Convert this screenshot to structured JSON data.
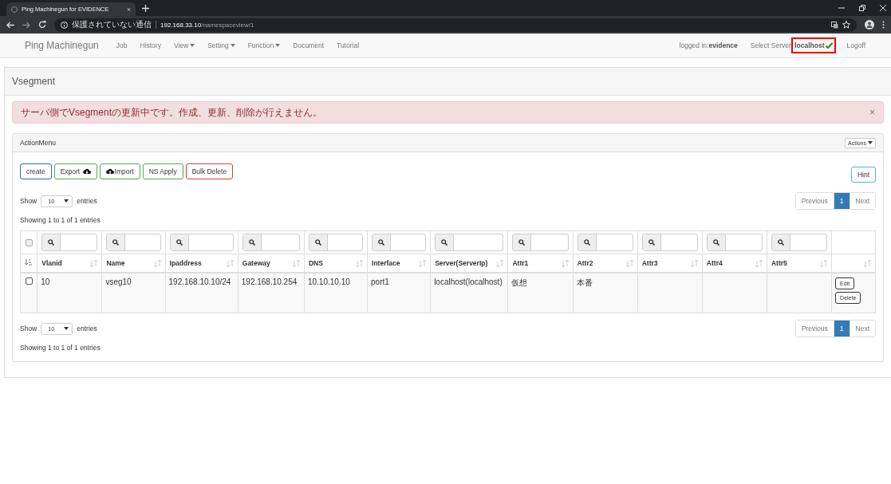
{
  "browser": {
    "tab_title": "Ping Machinegun for EVIDENCE",
    "tab_close": "×",
    "url_warning": "保護されていない通信",
    "url_host": "192.168.33.10",
    "url_path": "/namespaceview/1"
  },
  "navbar": {
    "brand": "Ping Machinegun",
    "items": [
      {
        "label": "Job",
        "dropdown": false
      },
      {
        "label": "History",
        "dropdown": false
      },
      {
        "label": "View",
        "dropdown": true
      },
      {
        "label": "Setting",
        "dropdown": true
      },
      {
        "label": "Function",
        "dropdown": true
      },
      {
        "label": "Document",
        "dropdown": false
      },
      {
        "label": "Tutorial",
        "dropdown": false
      }
    ],
    "logged_in_label": "logged in:",
    "user": "evidence",
    "select_server_label": "Select Server:",
    "server": "localhost",
    "server_ok": true,
    "server_highlighted": true,
    "logoff": "Logoff"
  },
  "page_title": "Vsegment",
  "alert": {
    "message": "サーバ側でVsegmentの更新中です。作成、更新、削除が行えません。",
    "dismiss": "×"
  },
  "panel": {
    "title": "ActionMenu",
    "actions_button": "Actions",
    "buttons": [
      {
        "label": "create",
        "kind": "primary"
      },
      {
        "label": "Export",
        "kind": "export"
      },
      {
        "label": "Import",
        "kind": "import"
      },
      {
        "label": "NS Apply",
        "kind": "success"
      },
      {
        "label": "Bulk Delete",
        "kind": "danger"
      }
    ],
    "hint": "Hint",
    "length_top": {
      "show": "Show",
      "value": "10",
      "entries": "entries"
    },
    "info_top": "Showing 1 to 1 of 1 entries",
    "pagination_top": {
      "previous": "Previous",
      "pages": [
        {
          "label": "1",
          "selected": true
        }
      ],
      "next": "Next"
    },
    "table": {
      "select_all_checked": false,
      "columns": [
        {
          "label": "Vlanid",
          "filter": true
        },
        {
          "label": "Name",
          "filter": true
        },
        {
          "label": "Ipaddress",
          "filter": true
        },
        {
          "label": "Gateway",
          "filter": true
        },
        {
          "label": "DNS",
          "filter": true
        },
        {
          "label": "Interface",
          "filter": true
        },
        {
          "label": "Server(ServerIp)",
          "filter": true
        },
        {
          "label": "Attr1",
          "filter": true
        },
        {
          "label": "Attr2",
          "filter": true
        },
        {
          "label": "Attr3",
          "filter": true
        },
        {
          "label": "Attr4",
          "filter": true
        },
        {
          "label": "Attr5",
          "filter": true
        },
        {
          "filter": false
        }
      ],
      "rows": [
        {
          "checked": false,
          "cells": [
            "10",
            "vseg10",
            "192.168.10.10/24",
            "192.168.10.254",
            "10.10.10.10",
            "port1",
            "localhost(localhost)",
            "仮想",
            "本番",
            "",
            "",
            ""
          ],
          "edit": "Edit",
          "delete": "Delete"
        }
      ]
    },
    "length_bottom": {
      "show": "Show",
      "value": "10",
      "entries": "entries"
    },
    "info_bottom": "Showing 1 to 1 of 1 entries",
    "pagination_bottom": {
      "previous": "Previous",
      "pages": [
        {
          "label": "1",
          "selected": true
        }
      ],
      "next": "Next"
    }
  }
}
